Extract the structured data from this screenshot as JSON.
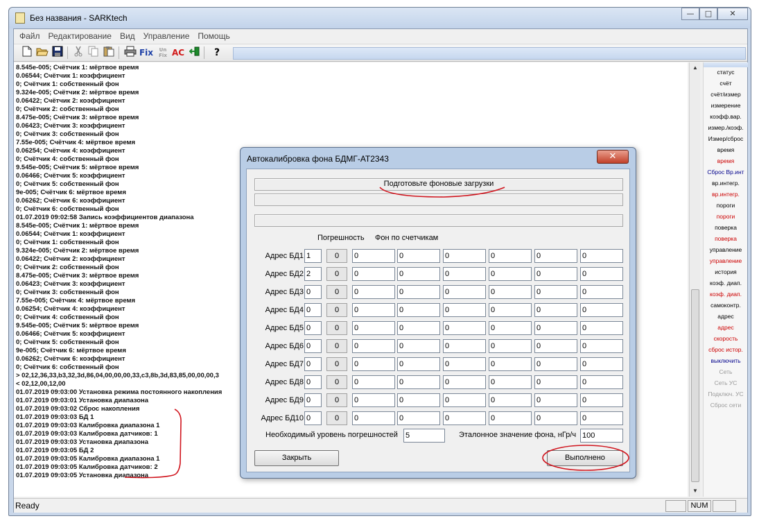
{
  "window": {
    "title": "Без названия - SARKtech",
    "controls": {
      "minimize": "—",
      "maximize": "□",
      "close": "✕"
    }
  },
  "menu": [
    "Файл",
    "Редактирование",
    "Вид",
    "Управление",
    "Помощь"
  ],
  "toolbar": {
    "fix": "Fix",
    "unfix_top": "Un",
    "unfix_bottom": "Fix",
    "ac": "AC",
    "help": "?",
    "icons": [
      "new-icon",
      "open-icon",
      "save-icon",
      "cut-icon",
      "copy-icon",
      "paste-icon",
      "print-icon",
      "fix-icon",
      "unfix-icon",
      "ac-icon",
      "exit-icon",
      "help-icon"
    ]
  },
  "log": [
    "8.545e-005; Счётчик 1: мёртвое время",
    "0.06544; Счётчик 1: коэффициент",
    "0; Счётчик 1: собственный фон",
    "9.324e-005; Счётчик 2: мёртвое время",
    "0.06422; Счётчик 2: коэффициент",
    "0; Счётчик 2: собственный фон",
    "8.475e-005; Счётчик 3: мёртвое время",
    "0.06423; Счётчик 3: коэффициент",
    "0; Счётчик 3: собственный фон",
    "7.55e-005; Счётчик 4: мёртвое время",
    "0.06254; Счётчик 4: коэффициент",
    "0; Счётчик 4: собственный фон",
    "9.545e-005; Счётчик 5: мёртвое время",
    "0.06466; Счётчик 5: коэффициент",
    "0; Счётчик 5: собственный фон",
    "9e-005; Счётчик 6: мёртвое время",
    "0.06262; Счётчик 6: коэффициент",
    "0; Счётчик 6: собственный фон",
    "01.07.2019 09:02:58   Запись коэффициентов диапазона",
    "8.545e-005; Счётчик 1: мёртвое время",
    "0.06544; Счётчик 1: коэффициент",
    "0; Счётчик 1: собственный фон",
    "9.324e-005; Счётчик 2: мёртвое время",
    "0.06422; Счётчик 2: коэффициент",
    "0; Счётчик 2: собственный фон",
    "8.475e-005; Счётчик 3: мёртвое время",
    "0.06423; Счётчик 3: коэффициент",
    "0; Счётчик 3: собственный фон",
    "7.55e-005; Счётчик 4: мёртвое время",
    "0.06254; Счётчик 4: коэффициент",
    "0; Счётчик 4: собственный фон",
    "9.545e-005; Счётчик 5: мёртвое время",
    "0.06466; Счётчик 5: коэффициент",
    "0; Счётчик 5: собственный фон",
    "9e-005; Счётчик 6: мёртвое время",
    "0.06262; Счётчик 6: коэффициент",
    "0; Счётчик 6: собственный фон",
    "> 02,12,36,33,b3,32,3d,86,04,00,00,00,33,c3,8b,3d,83,85,00,00,00,3",
    "< 02,12,00,12,00",
    "01.07.2019 09:03:00   Установка режима постоянного накопления",
    "01.07.2019 09:03:01   Установка диапазона",
    "01.07.2019 09:03:02   Сброс накопления",
    "01.07.2019 09:03:03   БД 1",
    "01.07.2019 09:03:03   Калибровка диапазона 1",
    "01.07.2019 09:03:03   Калибровка датчиков: 1",
    "01.07.2019 09:03:03   Установка диапазона",
    "01.07.2019 09:03:05   БД 2",
    "01.07.2019 09:03:05   Калибровка диапазона 1",
    "01.07.2019 09:03:05   Калибровка датчиков: 2",
    "01.07.2019 09:03:05   Установка диапазона"
  ],
  "side_panel": [
    {
      "label": "статус",
      "color": "#000000",
      "enabled": true
    },
    {
      "label": "счёт",
      "color": "#000000",
      "enabled": true
    },
    {
      "label": "счёт/измер",
      "color": "#000000",
      "enabled": true
    },
    {
      "label": "измерение",
      "color": "#000000",
      "enabled": true
    },
    {
      "label": "коэфф.вар.",
      "color": "#000000",
      "enabled": true
    },
    {
      "label": "измер./коэф.",
      "color": "#000000",
      "enabled": true
    },
    {
      "label": "Измер/сброс",
      "color": "#000000",
      "enabled": true
    },
    {
      "label": "время",
      "color": "#000000",
      "enabled": true
    },
    {
      "label": "время",
      "color": "#cc0000",
      "enabled": true
    },
    {
      "label": "Сброс Вр.инт",
      "color": "#00008b",
      "enabled": true
    },
    {
      "label": "вр.интегр.",
      "color": "#000000",
      "enabled": true
    },
    {
      "label": "вр.интегр.",
      "color": "#cc0000",
      "enabled": true
    },
    {
      "label": "пороги",
      "color": "#000000",
      "enabled": true
    },
    {
      "label": "пороги",
      "color": "#cc0000",
      "enabled": true
    },
    {
      "label": "поверка",
      "color": "#000000",
      "enabled": true
    },
    {
      "label": "поверка",
      "color": "#cc0000",
      "enabled": true
    },
    {
      "label": "управление",
      "color": "#000000",
      "enabled": true
    },
    {
      "label": "управление",
      "color": "#cc0000",
      "enabled": true
    },
    {
      "label": "история",
      "color": "#000000",
      "enabled": true
    },
    {
      "label": "коэф. диап.",
      "color": "#000000",
      "enabled": true
    },
    {
      "label": "коэф. диап.",
      "color": "#cc0000",
      "enabled": true
    },
    {
      "label": "самоконтр.",
      "color": "#000000",
      "enabled": true
    },
    {
      "label": "адрес",
      "color": "#000000",
      "enabled": true
    },
    {
      "label": "адрес",
      "color": "#cc0000",
      "enabled": true
    },
    {
      "label": "скорость",
      "color": "#cc0000",
      "enabled": true
    },
    {
      "label": "сброс истор.",
      "color": "#cc0000",
      "enabled": true
    },
    {
      "label": "выключить",
      "color": "#00008b",
      "enabled": true
    },
    {
      "label": "Сеть",
      "color": "#9a9a9a",
      "enabled": false
    },
    {
      "label": "Сеть  УС",
      "color": "#9a9a9a",
      "enabled": false
    },
    {
      "label": "Подключ. УС",
      "color": "#9a9a9a",
      "enabled": false
    },
    {
      "label": "Сброс сети",
      "color": "#9a9a9a",
      "enabled": false
    }
  ],
  "statusbar": {
    "text": "Ready",
    "num": "NUM"
  },
  "dialog": {
    "title": "Автокалибровка фона БДМГ-АТ2343",
    "close": "✕",
    "message": "Подготовьте фоновые загрузки",
    "col_error": "Погрешность",
    "col_background": "Фон по счетчикам",
    "rows": [
      {
        "label": "Адрес БД1",
        "address": "1",
        "error": "0",
        "counters": [
          "0",
          "0",
          "0",
          "0",
          "0",
          "0"
        ]
      },
      {
        "label": "Адрес БД2",
        "address": "2",
        "error": "0",
        "counters": [
          "0",
          "0",
          "0",
          "0",
          "0",
          "0"
        ]
      },
      {
        "label": "Адрес БД3",
        "address": "0",
        "error": "0",
        "counters": [
          "0",
          "0",
          "0",
          "0",
          "0",
          "0"
        ]
      },
      {
        "label": "Адрес БД4",
        "address": "0",
        "error": "0",
        "counters": [
          "0",
          "0",
          "0",
          "0",
          "0",
          "0"
        ]
      },
      {
        "label": "Адрес БД5",
        "address": "0",
        "error": "0",
        "counters": [
          "0",
          "0",
          "0",
          "0",
          "0",
          "0"
        ]
      },
      {
        "label": "Адрес БД6",
        "address": "0",
        "error": "0",
        "counters": [
          "0",
          "0",
          "0",
          "0",
          "0",
          "0"
        ]
      },
      {
        "label": "Адрес БД7",
        "address": "0",
        "error": "0",
        "counters": [
          "0",
          "0",
          "0",
          "0",
          "0",
          "0"
        ]
      },
      {
        "label": "Адрес БД8",
        "address": "0",
        "error": "0",
        "counters": [
          "0",
          "0",
          "0",
          "0",
          "0",
          "0"
        ]
      },
      {
        "label": "Адрес БД9",
        "address": "0",
        "error": "0",
        "counters": [
          "0",
          "0",
          "0",
          "0",
          "0",
          "0"
        ]
      },
      {
        "label": "Адрес БД10",
        "address": "0",
        "error": "0",
        "counters": [
          "0",
          "0",
          "0",
          "0",
          "0",
          "0"
        ]
      }
    ],
    "required_error_label": "Необходимый уровень погрешностей",
    "required_error_value": "5",
    "reference_label": "Эталонное значение фона, нГр/ч",
    "reference_value": "100",
    "close_button": "Закрыть",
    "done_button": "Выполнено"
  }
}
